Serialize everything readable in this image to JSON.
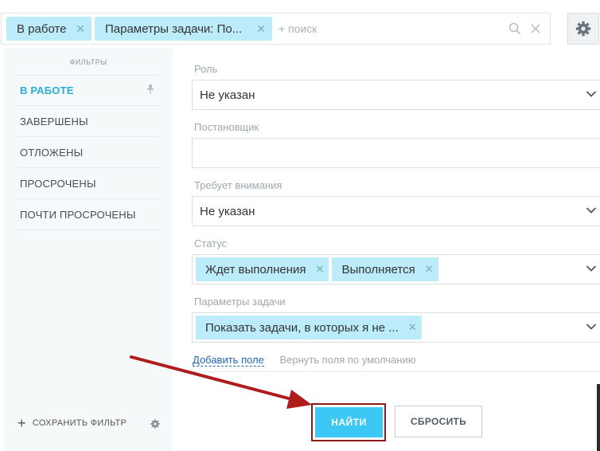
{
  "search": {
    "chips": [
      {
        "label": "В работе"
      },
      {
        "label": "Параметры задачи: По..."
      }
    ],
    "placeholder": "+ поиск"
  },
  "sidebar": {
    "title": "ФИЛЬТРЫ",
    "items": [
      {
        "label": "В РАБОТЕ"
      },
      {
        "label": "ЗАВЕРШЕНЫ"
      },
      {
        "label": "ОТЛОЖЕНЫ"
      },
      {
        "label": "ПРОСРОЧЕНЫ"
      },
      {
        "label": "ПОЧТИ ПРОСРОЧЕНЫ"
      }
    ],
    "save_filter": "СОХРАНИТЬ ФИЛЬТР"
  },
  "fields": {
    "role": {
      "label": "Роль",
      "value": "Не указан"
    },
    "creator": {
      "label": "Постановщик",
      "value": ""
    },
    "attention": {
      "label": "Требует внимания",
      "value": "Не указан"
    },
    "status": {
      "label": "Статус",
      "tags": [
        "Ждет выполнения",
        "Выполняется"
      ]
    },
    "params": {
      "label": "Параметры задачи",
      "tags": [
        "Показать задачи, в которых я не ..."
      ]
    }
  },
  "links": {
    "add_field": "Добавить поле",
    "reset_fields": "Вернуть поля по умолчанию"
  },
  "buttons": {
    "find": "НАЙТИ",
    "reset": "СБРОСИТЬ"
  },
  "colors": {
    "accent": "#3bc8f5",
    "chip": "#bcecfa",
    "annotation": "#b01c1c"
  }
}
